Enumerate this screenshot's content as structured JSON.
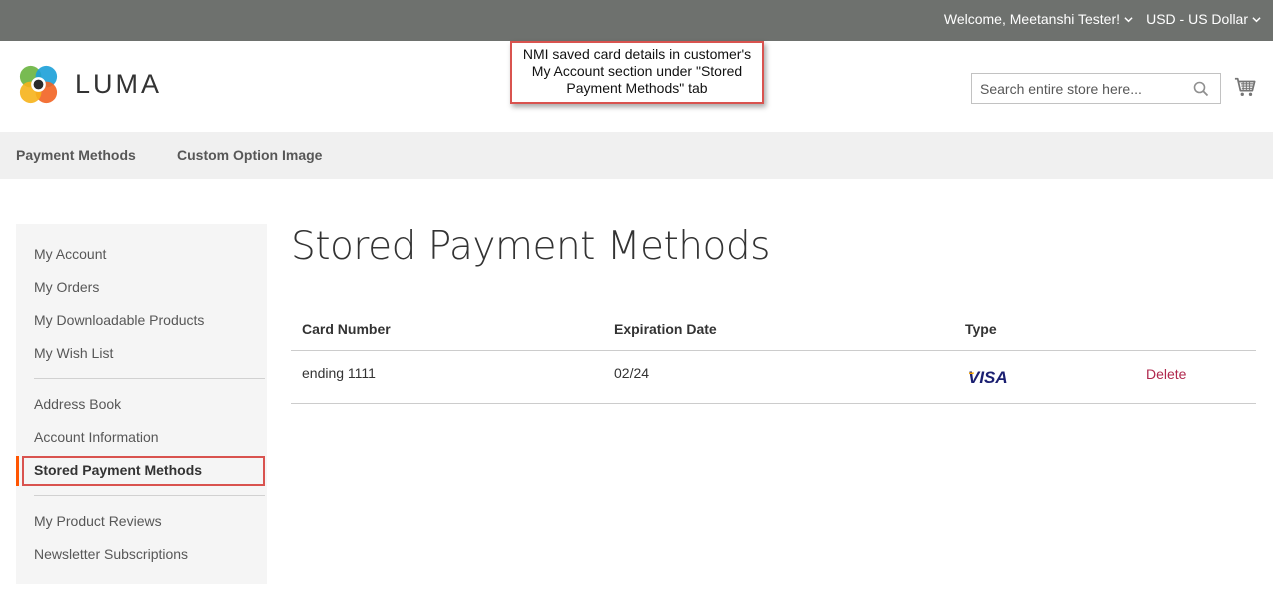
{
  "topbar": {
    "welcome": "Welcome, Meetanshi Tester!",
    "currency": "USD - US Dollar"
  },
  "header": {
    "logo_text": "LUMA",
    "search_placeholder": "Search entire store here..."
  },
  "callout": {
    "line1": "NMI saved card details in customer's",
    "line2": "My Account section under \"Stored",
    "line3": "Payment Methods\" tab"
  },
  "nav": {
    "items": [
      "Payment Methods",
      "Custom Option Image"
    ]
  },
  "sidebar": {
    "items": [
      "My Account",
      "My Orders",
      "My Downloadable Products",
      "My Wish List",
      "Address Book",
      "Account Information",
      "Stored Payment Methods",
      "My Product Reviews",
      "Newsletter Subscriptions"
    ],
    "active": "Stored Payment Methods"
  },
  "main": {
    "title": "Stored Payment Methods",
    "table": {
      "headers": [
        "Card Number",
        "Expiration Date",
        "Type"
      ],
      "rows": [
        {
          "card_number": "ending 1111",
          "expiration": "02/24",
          "type": "VISA",
          "action": "Delete"
        }
      ]
    }
  },
  "colors": {
    "topbar": "#6e716e",
    "nav_bg": "#f0f0f0",
    "sidebar_bg": "#f5f5f5",
    "active_accent": "#ff5501",
    "callout_border": "#d9534f",
    "delete_link": "#b0274d",
    "visa_blue": "#1a1f71",
    "visa_gold": "#f7a600"
  }
}
